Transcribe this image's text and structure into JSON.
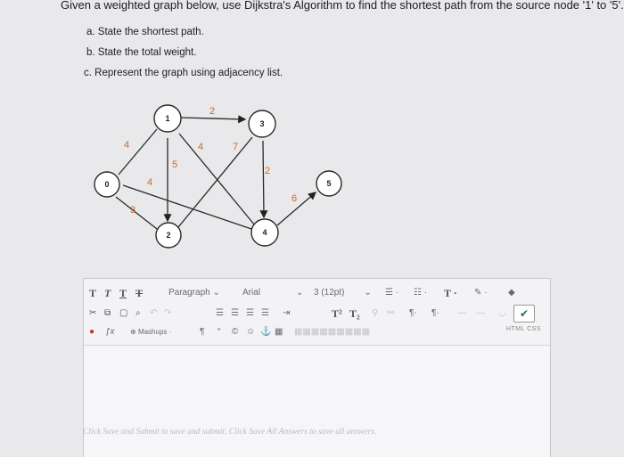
{
  "question": {
    "text": "Given a weighted graph below, use Dijkstra's Algorithm to find the shortest path from the source node '1' to '5'.",
    "parts": [
      "a. State the shortest path.",
      "b. State the total weight.",
      "c. Represent the graph using adjacency list."
    ]
  },
  "graph": {
    "nodes": [
      "0",
      "1",
      "2",
      "3",
      "4",
      "5"
    ],
    "edges": [
      {
        "from": "1",
        "to": "3",
        "weight": "2"
      },
      {
        "from": "0",
        "to": "1",
        "weight": "4"
      },
      {
        "from": "1",
        "to": "4",
        "weight": "4"
      },
      {
        "from": "3",
        "to": "2",
        "weight": "7"
      },
      {
        "from": "1",
        "to": "2",
        "weight": "5"
      },
      {
        "from": "3",
        "to": "4",
        "weight": "2"
      },
      {
        "from": "0",
        "to": "4",
        "weight": "4"
      },
      {
        "from": "0",
        "to": "2",
        "weight": "3"
      },
      {
        "from": "4",
        "to": "5",
        "weight": "6"
      }
    ]
  },
  "editor": {
    "format_T1": "T",
    "format_T2": "T",
    "format_T3": "T",
    "format_T4": "T",
    "paragraph_label": "Paragraph",
    "font_label": "Arial",
    "size_label": "3 (12pt)",
    "mashups_label": "Mashups",
    "htmlcss_label": "HTML CSS",
    "superscript": "T²",
    "subscript": "T₂"
  },
  "hint": "Click Save and Submit to save and submit. Click Save All Answers to save all answers."
}
